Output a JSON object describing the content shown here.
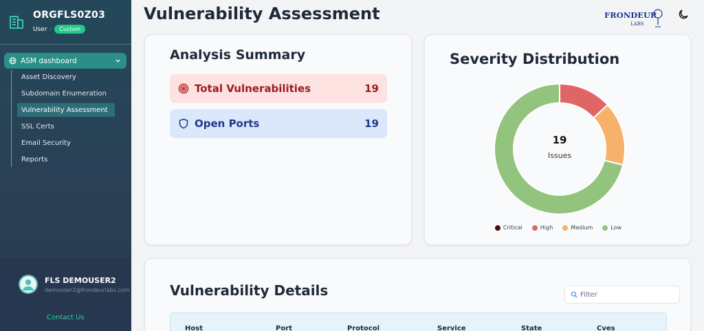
{
  "sidebar": {
    "org_name": "ORGFLS0Z03",
    "role": "User",
    "role_sep": "·",
    "plan_badge": "Custom",
    "nav_parent": "ASM dashboard",
    "items": [
      {
        "label": "Asset Discovery"
      },
      {
        "label": "Subdomain Enumeration"
      },
      {
        "label": "Vulnerability Assessment",
        "active": true
      },
      {
        "label": "SSL Certs"
      },
      {
        "label": "Email Security"
      },
      {
        "label": "Reports"
      }
    ],
    "user_name": "FLS DEMOUSER2",
    "user_email": "demouser2@frondeurlabs.com",
    "contact": "Contact Us"
  },
  "header": {
    "title": "Vulnerability Assessment",
    "logo_text": "FRONDEUR",
    "logo_sub": "LABS",
    "theme_icon": "moon-icon"
  },
  "summary": {
    "title": "Analysis Summary",
    "total_label": "Total Vulnerabilities",
    "total_value": "19",
    "ports_label": "Open Ports",
    "ports_value": "19"
  },
  "severity": {
    "title": "Severity Distribution",
    "center_value": "19",
    "center_label": "Issues"
  },
  "chart_data": {
    "type": "pie",
    "categories": [
      "Critical",
      "High",
      "Medium",
      "Low"
    ],
    "values": [
      0,
      2.5,
      3,
      13.5
    ],
    "colors": [
      "#4a0f14",
      "#e06666",
      "#f6b26b",
      "#93c47d"
    ],
    "legend_position": "bottom"
  },
  "details": {
    "title": "Vulnerability Details",
    "filter_placeholder": "Filter",
    "columns": [
      "Host",
      "Port",
      "Protocol",
      "Service",
      "State",
      "Cves"
    ]
  }
}
